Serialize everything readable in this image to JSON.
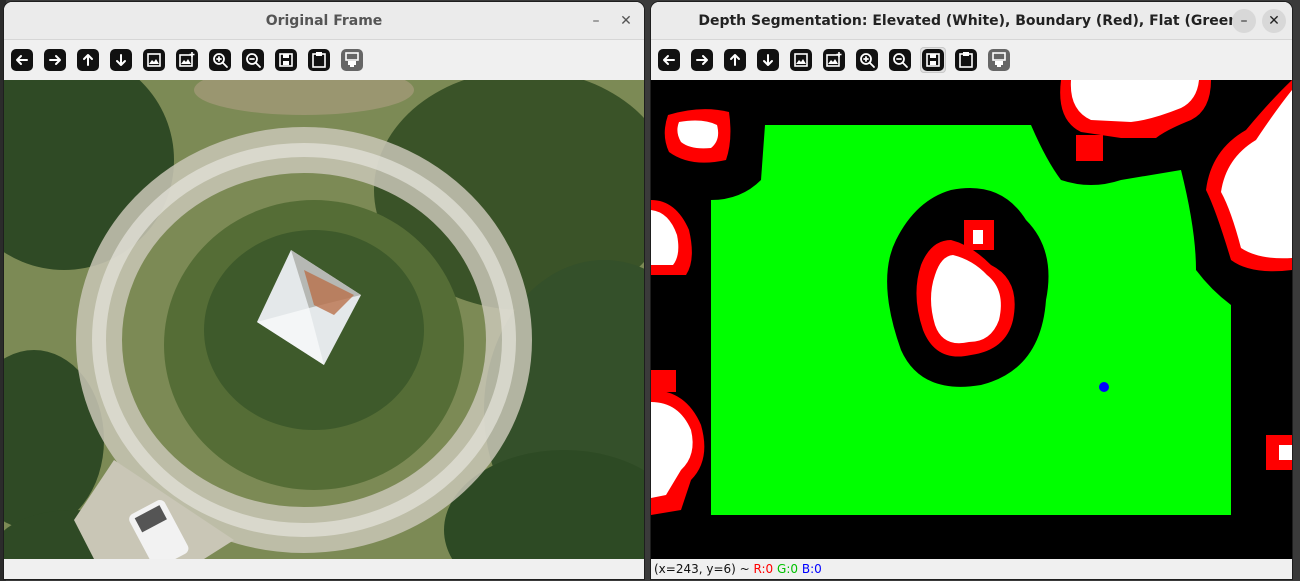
{
  "left_window": {
    "title": "Original Frame",
    "minimize": "–",
    "close": "✕",
    "toolbar": [
      "arrow-left-icon",
      "arrow-right-icon",
      "arrow-up-icon",
      "arrow-down-icon",
      "image-icon",
      "image-plus-icon",
      "zoom-in-icon",
      "zoom-out-icon",
      "save-icon",
      "clipboard-icon",
      "properties-icon"
    ]
  },
  "right_window": {
    "title": "Depth Segmentation: Elevated (White), Boundary (Red), Flat (Green)",
    "minimize": "–",
    "close": "✕",
    "toolbar": [
      "arrow-left-icon",
      "arrow-right-icon",
      "arrow-up-icon",
      "arrow-down-icon",
      "image-icon",
      "image-plus-icon",
      "zoom-in-icon",
      "zoom-out-icon",
      "save-icon",
      "clipboard-icon",
      "properties-icon"
    ],
    "status": {
      "coords": "(x=243, y=6) ~",
      "r": "R:0",
      "g": "G:0",
      "b": "B:0"
    }
  },
  "colors": {
    "elevated": "#ffffff",
    "boundary": "#ff0000",
    "flat": "#00ff00",
    "background": "#000000",
    "marker": "#0000ff"
  }
}
